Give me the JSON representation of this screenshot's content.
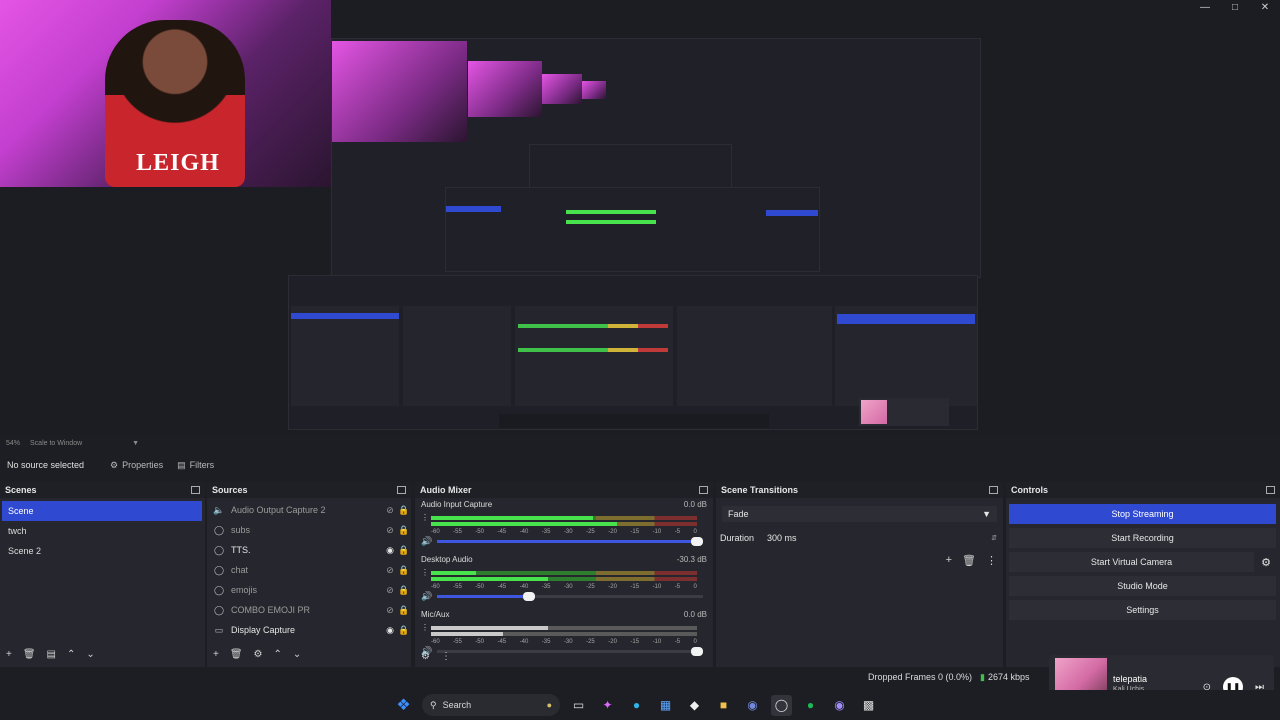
{
  "preview": {
    "zoom": "54%",
    "scale_mode": "Scale to Window",
    "webcam_text": "LEIGH"
  },
  "source_toolbar": {
    "no_source": "No source selected",
    "properties": "Properties",
    "filters": "Filters"
  },
  "scenes": {
    "title": "Scenes",
    "items": [
      {
        "label": "Scene",
        "active": true
      },
      {
        "label": "twch",
        "active": false
      },
      {
        "label": "Scene 2",
        "active": false
      }
    ]
  },
  "sources": {
    "title": "Sources",
    "items": [
      {
        "label": "Audio Output Capture 2",
        "icon": "speaker-icon",
        "visible": false
      },
      {
        "label": "subs",
        "icon": "globe-icon",
        "visible": false
      },
      {
        "label": "TTS.",
        "icon": "globe-icon",
        "visible": true
      },
      {
        "label": "chat",
        "icon": "globe-icon",
        "visible": false
      },
      {
        "label": "emojis",
        "icon": "globe-icon",
        "visible": false
      },
      {
        "label": "COMBO EMOJI PR",
        "icon": "globe-icon",
        "visible": false
      },
      {
        "label": "Display Capture",
        "icon": "monitor-icon",
        "visible": true
      }
    ]
  },
  "audio_mixer": {
    "title": "Audio Mixer",
    "scale": [
      "-60",
      "-55",
      "-50",
      "-45",
      "-40",
      "-35",
      "-30",
      "-25",
      "-20",
      "-15",
      "-10",
      "-5",
      "0"
    ],
    "tracks": [
      {
        "name": "Audio Input Capture",
        "db": "0.0 dB",
        "level": 0.61,
        "level2": 0.7,
        "volume": 1.0,
        "muted": false
      },
      {
        "name": "Desktop Audio",
        "db": "-30.3 dB",
        "level": 0.17,
        "level2": 0.44,
        "volume": 0.37,
        "muted": false
      },
      {
        "name": "Mic/Aux",
        "db": "0.0 dB",
        "level": 0.44,
        "level2": 0.27,
        "volume": 1.0,
        "muted": true
      }
    ]
  },
  "scene_transitions": {
    "title": "Scene Transitions",
    "transition": "Fade",
    "duration_label": "Duration",
    "duration_value": "300 ms"
  },
  "controls": {
    "title": "Controls",
    "stop_streaming": "Stop Streaming",
    "start_recording": "Start Recording",
    "start_virtual_camera": "Start Virtual Camera",
    "studio_mode": "Studio Mode",
    "settings": "Settings"
  },
  "status": {
    "dropped_frames": "Dropped Frames 0 (0.0%)",
    "bitrate": "2674 kbps"
  },
  "media": {
    "title": "telepatia",
    "artist": "Kali Uchis"
  },
  "taskbar": {
    "search_label": "Search"
  },
  "colors": {
    "accent": "#2f49d1",
    "meter_green": "#48e24d",
    "background": "#1d1e24"
  }
}
